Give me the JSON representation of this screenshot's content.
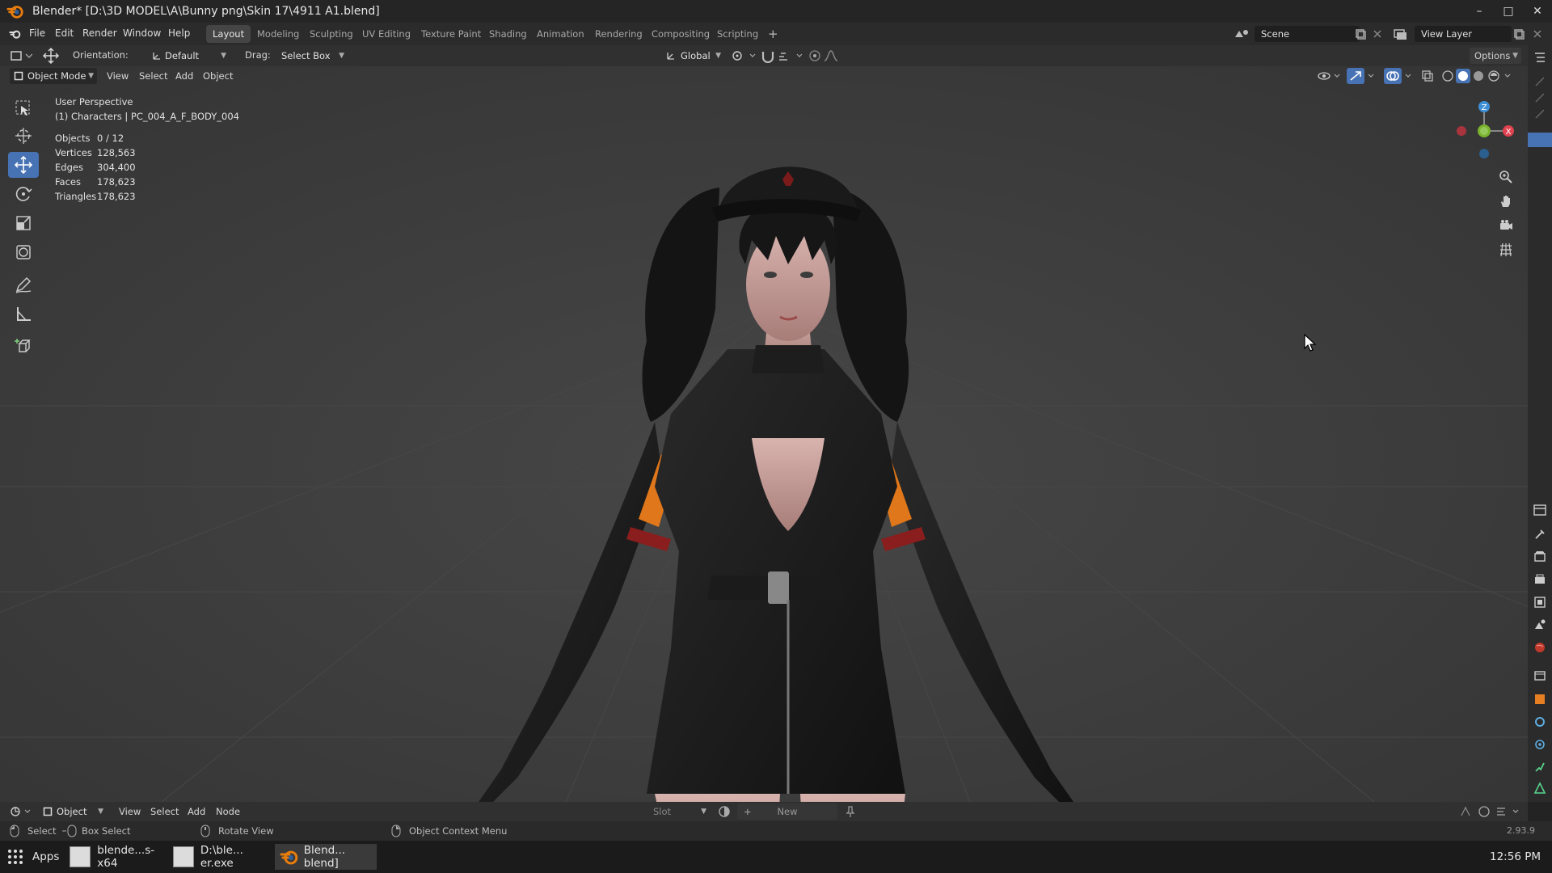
{
  "titlebar": {
    "title": "Blender* [D:\\3D MODEL\\A\\Bunny png\\Skin 17\\4911 A1.blend]",
    "minimize": "–",
    "maximize": "□",
    "close": "✕"
  },
  "menubar": {
    "menus": [
      "File",
      "Edit",
      "Render",
      "Window",
      "Help"
    ],
    "workspaces": [
      "Layout",
      "Modeling",
      "Sculpting",
      "UV Editing",
      "Texture Paint",
      "Shading",
      "Animation",
      "Rendering",
      "Compositing",
      "Scripting"
    ],
    "active_workspace": "Layout",
    "add_tab": "+",
    "scene": "Scene",
    "view_layer": "View Layer"
  },
  "header": {
    "orientation_label": "Orientation:",
    "orientation_value": "Default",
    "drag_label": "Drag:",
    "drag_value": "Select Box",
    "transform_orientation": "Global",
    "options": "Options"
  },
  "viewport_header": {
    "mode": "Object Mode",
    "menus": [
      "View",
      "Select",
      "Add",
      "Object"
    ]
  },
  "overlay": {
    "perspective": "User Perspective",
    "active_object": "(1) Characters | PC_004_A_F_BODY_004",
    "stats": [
      {
        "label": "Objects",
        "value": "0 / 12"
      },
      {
        "label": "Vertices",
        "value": "128,563"
      },
      {
        "label": "Edges",
        "value": "304,400"
      },
      {
        "label": "Faces",
        "value": "178,623"
      },
      {
        "label": "Triangles",
        "value": "178,623"
      }
    ]
  },
  "gizmo": {
    "z": "Z",
    "x": "X"
  },
  "node_header": {
    "type": "Object",
    "menus": [
      "View",
      "Select",
      "Add",
      "Node"
    ],
    "slot": "Slot",
    "new_button": "New"
  },
  "statusbar": {
    "select": "Select",
    "box_select": "Box Select",
    "rotate_view": "Rotate View",
    "context_menu": "Object Context Menu",
    "version": "2.93.9"
  },
  "taskbar": {
    "apps": "Apps",
    "tasks": [
      "blende...s-x64",
      "D:\\ble... er.exe",
      "Blend... blend]"
    ],
    "clock": "12:56 PM"
  },
  "colors": {
    "accent": "#4772b3",
    "viewport_bg": "#3d3d3d",
    "axis_x": "#e0434f",
    "axis_y": "#7bb32e",
    "axis_z": "#3f8fd6"
  }
}
